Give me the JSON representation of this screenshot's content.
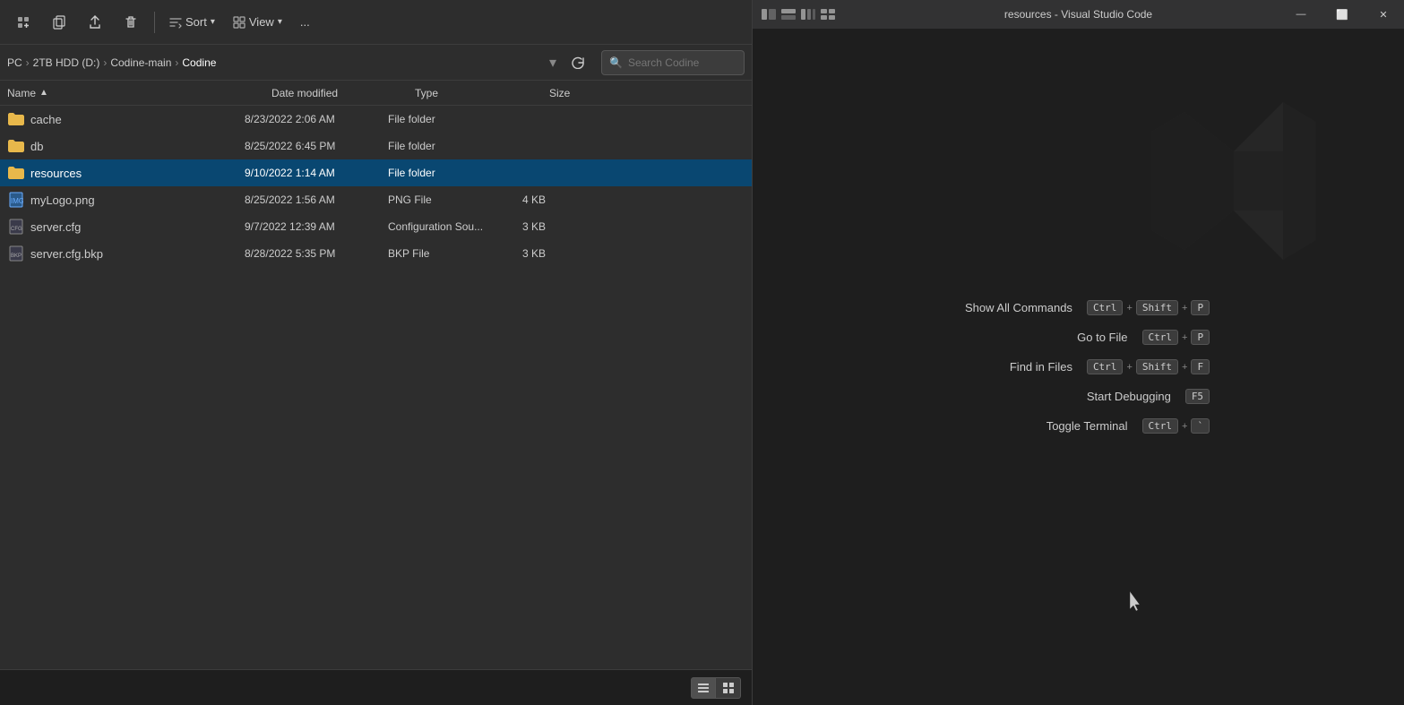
{
  "explorer": {
    "toolbar": {
      "new_btn_label": "⊕",
      "copy_btn_label": "⧉",
      "share_btn_label": "⬆",
      "delete_btn_label": "🗑",
      "sort_label": "Sort",
      "view_label": "View",
      "more_label": "..."
    },
    "breadcrumb": {
      "pc": "PC",
      "hdd": "2TB HDD (D:)",
      "parent": "Codine-main",
      "current": "Codine"
    },
    "search": {
      "placeholder": "Search Codine"
    },
    "columns": {
      "name": "Name",
      "date_modified": "Date modified",
      "type": "Type",
      "size": "Size"
    },
    "files": [
      {
        "name": "cache",
        "date_modified": "8/23/2022 2:06 AM",
        "type": "File folder",
        "size": "",
        "kind": "folder",
        "selected": false,
        "highlighted": false
      },
      {
        "name": "db",
        "date_modified": "8/25/2022 6:45 PM",
        "type": "File folder",
        "size": "",
        "kind": "folder",
        "selected": false,
        "highlighted": false
      },
      {
        "name": "resources",
        "date_modified": "9/10/2022 1:14 AM",
        "type": "File folder",
        "size": "",
        "kind": "folder",
        "selected": false,
        "highlighted": true
      },
      {
        "name": "myLogo.png",
        "date_modified": "8/25/2022 1:56 AM",
        "type": "PNG File",
        "size": "4 KB",
        "kind": "image",
        "selected": false,
        "highlighted": false
      },
      {
        "name": "server.cfg",
        "date_modified": "9/7/2022 12:39 AM",
        "type": "Configuration Sou...",
        "size": "3 KB",
        "kind": "config",
        "selected": false,
        "highlighted": false
      },
      {
        "name": "server.cfg.bkp",
        "date_modified": "8/28/2022 5:35 PM",
        "type": "BKP File",
        "size": "3 KB",
        "kind": "bkp",
        "selected": false,
        "highlighted": false
      }
    ],
    "view_modes": [
      "list",
      "grid"
    ]
  },
  "vscode": {
    "title": "resources - Visual Studio Code",
    "shortcuts": [
      {
        "name": "Show All Commands",
        "keys": [
          "Ctrl",
          "+",
          "Shift",
          "+",
          "P"
        ]
      },
      {
        "name": "Go to File",
        "keys": [
          "Ctrl",
          "+",
          "P"
        ]
      },
      {
        "name": "Find in Files",
        "keys": [
          "Ctrl",
          "+",
          "Shift",
          "+",
          "F"
        ]
      },
      {
        "name": "Start Debugging",
        "keys": [
          "F5"
        ]
      },
      {
        "name": "Toggle Terminal",
        "keys": [
          "Ctrl",
          "+",
          "`"
        ]
      }
    ]
  }
}
